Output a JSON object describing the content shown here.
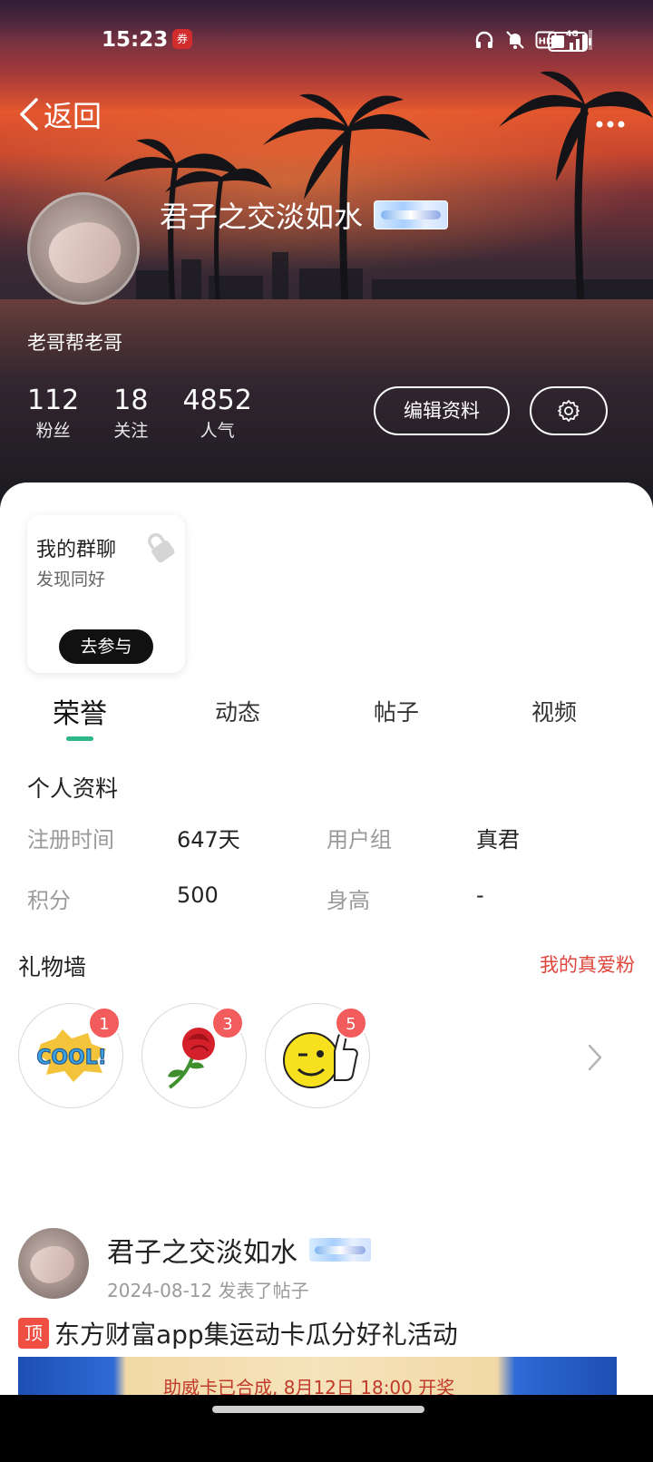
{
  "status_bar": {
    "time": "15:23",
    "app_badge": "券"
  },
  "nav": {
    "back_label": "返回"
  },
  "profile": {
    "name": "君子之交淡如水",
    "bio": "老哥帮老哥",
    "stats": [
      {
        "num": "112",
        "label": "粉丝"
      },
      {
        "num": "18",
        "label": "关注"
      },
      {
        "num": "4852",
        "label": "人气"
      }
    ],
    "edit_label": "编辑资料"
  },
  "group_card": {
    "title": "我的群聊",
    "subtitle": "发现同好",
    "join_label": "去参与"
  },
  "tabs": [
    "荣誉",
    "动态",
    "帖子",
    "视频"
  ],
  "personal_info": {
    "title": "个人资料",
    "rows": [
      {
        "label1": "注册时间",
        "value1": "647天",
        "label2": "用户组",
        "value2": "真君"
      },
      {
        "label1": "积分",
        "value1": "500",
        "label2": "身高",
        "value2": "-"
      }
    ]
  },
  "gift_wall": {
    "title": "礼物墙",
    "link": "我的真爱粉",
    "gifts": [
      {
        "icon": "cool-sticker-icon",
        "count": "1"
      },
      {
        "icon": "rose-icon",
        "count": "3"
      },
      {
        "icon": "thumbs-up-smiley-icon",
        "count": "5"
      }
    ]
  },
  "post": {
    "author": "君子之交淡如水",
    "meta": "2024-08-12  发表了帖子",
    "pin_tag": "顶",
    "title": "东方财富app集运动卡瓜分好礼活动",
    "image_caption": "助威卡已合成, 8月12日 18:00 开奖"
  },
  "colors": {
    "accent": "#2eb88a",
    "link_red": "#e0453b",
    "badge_red": "#f25c5c"
  }
}
